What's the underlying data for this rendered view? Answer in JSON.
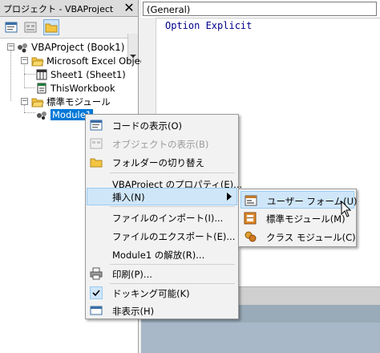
{
  "project_pane": {
    "title": "プロジェクト - VBAProject",
    "toolbar": [
      {
        "icon": "view-code-icon"
      },
      {
        "icon": "view-object-icon"
      },
      {
        "icon": "toggle-folders-icon"
      }
    ],
    "tree": {
      "root": "VBAProject (Book1)",
      "excel_objects_folder": "Microsoft Excel Objec",
      "sheet1": "Sheet1 (Sheet1)",
      "thisworkbook": "ThisWorkbook",
      "modules_folder": "標準モジュール",
      "module1": "Module1"
    }
  },
  "code_window": {
    "object_combo": "(General)",
    "code_line": "Option Explicit"
  },
  "context_menu": {
    "items": [
      {
        "label": "コードの表示(O)",
        "icon": "view-code-icon",
        "enabled": true
      },
      {
        "label": "オブジェクトの表示(B)",
        "icon": "view-object-icon",
        "enabled": false
      },
      {
        "label": "フォルダーの切り替え",
        "icon": "folder-icon",
        "enabled": true
      },
      {
        "label": "VBAProject のプロパティ(E)...",
        "enabled": true
      },
      {
        "label": "挿入(N)",
        "enabled": true,
        "highlighted": true,
        "has_submenu": true
      },
      {
        "label": "ファイルのインポート(I)...",
        "enabled": true
      },
      {
        "label": "ファイルのエクスポート(E)...",
        "enabled": true
      },
      {
        "label": "Module1 の解放(R)...",
        "enabled": true
      },
      {
        "label": "印刷(P)...",
        "icon": "printer-icon",
        "enabled": true
      },
      {
        "label": "ドッキング可能(K)",
        "icon": "check-icon",
        "enabled": true,
        "checked": true
      },
      {
        "label": "非表示(H)",
        "icon": "hide-window-icon",
        "enabled": true
      }
    ]
  },
  "insert_submenu": {
    "items": [
      {
        "label": "ユーザー フォーム(U)",
        "icon": "userform-icon",
        "highlighted": true
      },
      {
        "label": "標準モジュール(M)",
        "icon": "module-icon"
      },
      {
        "label": "クラス モジュール(C)",
        "icon": "class-module-icon"
      }
    ]
  },
  "colors": {
    "selection": "#0078d7",
    "menu_highlight": "#cfe6f9",
    "code_keyword": "#00008b"
  }
}
